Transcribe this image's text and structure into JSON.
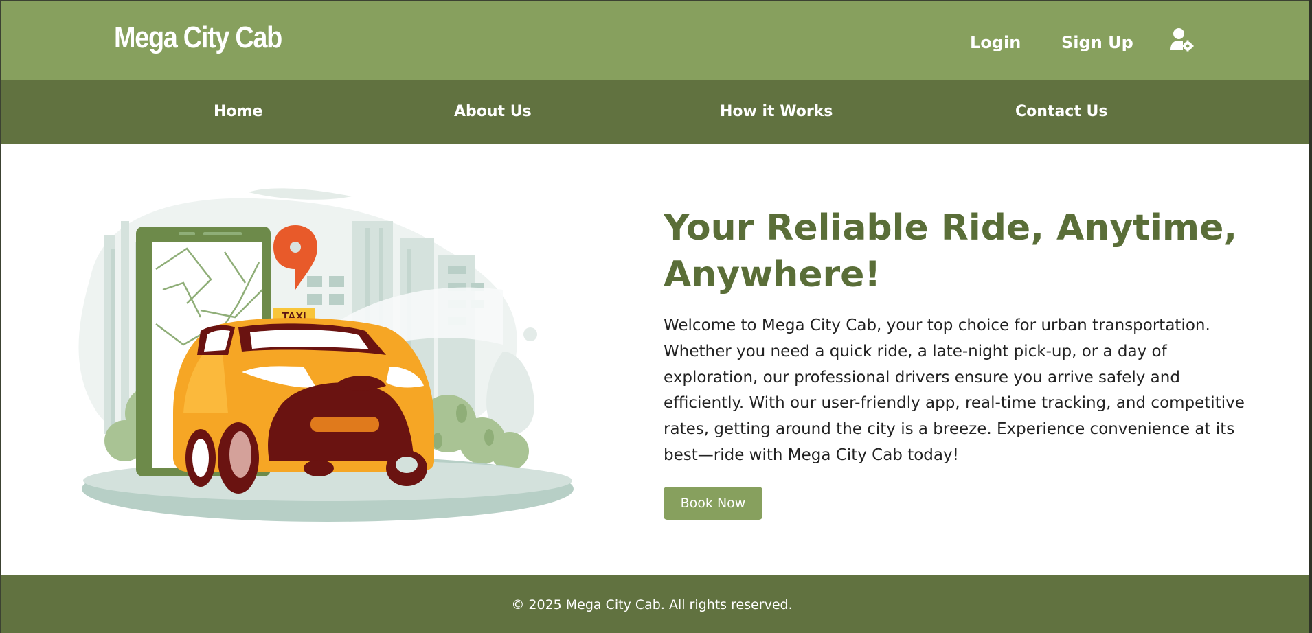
{
  "header": {
    "brand": "Mega City Cab",
    "login_label": "Login",
    "signup_label": "Sign Up",
    "admin_icon": "user-gear-icon"
  },
  "nav": {
    "items": [
      {
        "label": "Home"
      },
      {
        "label": "About Us"
      },
      {
        "label": "How it Works"
      },
      {
        "label": "Contact Us"
      }
    ]
  },
  "hero": {
    "title": "Your Reliable Ride, Anytime, Anywhere!",
    "body": "Welcome to Mega City Cab, your top choice for urban transportation. Whether you need a quick ride, a late-night pick-up, or a day of exploration, our professional drivers ensure you arrive safely and efficiently. With our user-friendly app, real-time tracking, and competitive rates, getting around the city is a breeze. Experience convenience at its best—ride with Mega City Cab today!",
    "button_label": "Book Now",
    "illustration": {
      "taxi_sign": "TAXI",
      "icons": [
        "map-pin-icon",
        "phone-map-icon",
        "taxi-car-icon"
      ]
    }
  },
  "footer": {
    "copyright": "© 2025 Mega City Cab. All rights reserved."
  },
  "colors": {
    "header_green": "#87a05e",
    "nav_green": "#617240",
    "title_green": "#5a6e38",
    "taxi_yellow": "#f8b530",
    "pin_orange": "#e85a2a"
  }
}
